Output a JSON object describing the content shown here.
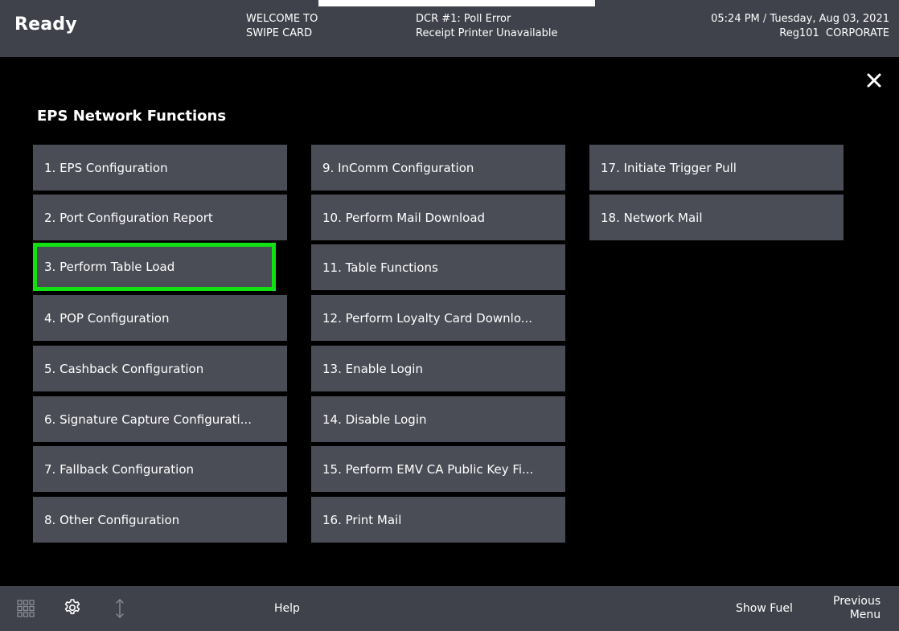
{
  "header": {
    "status": "Ready",
    "welcome_line1": "WELCOME TO",
    "welcome_line2": "SWIPE CARD",
    "alert_line1": "DCR #1: Poll Error",
    "alert_line2": "Receipt Printer Unavailable",
    "time": "05:24 PM",
    "date": "Tuesday, Aug 03, 2021",
    "register": "Reg101",
    "store": "CORPORATE"
  },
  "main": {
    "title": "EPS Network Functions",
    "buttons": [
      "1. EPS Configuration",
      "2. Port Configuration Report",
      "3. Perform Table Load",
      "4. POP Configuration",
      "5. Cashback Configuration",
      "6. Signature Capture Configurati...",
      "7. Fallback Configuration",
      "8. Other Configuration",
      "9. InComm Configuration",
      "10. Perform Mail Download",
      "11. Table Functions",
      "12. Perform Loyalty Card Downlo...",
      "13. Enable Login",
      "14. Disable Login",
      "15. Perform EMV CA Public Key Fi...",
      "16. Print Mail",
      "17. Initiate Trigger Pull",
      "18. Network Mail"
    ],
    "selected_index": 2,
    "highlight_color": "#12e012"
  },
  "footer": {
    "help": "Help",
    "show_fuel": "Show Fuel",
    "previous_line1": "Previous",
    "previous_line2": "Menu",
    "icons": [
      "grid-icon",
      "gear-icon",
      "updown-arrows-icon"
    ]
  }
}
